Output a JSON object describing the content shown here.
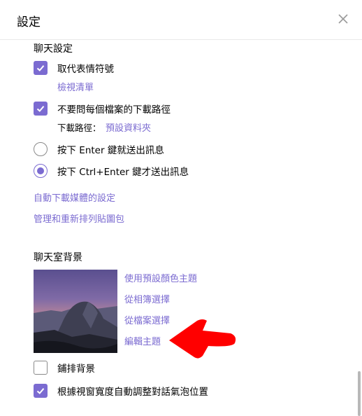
{
  "dialog": {
    "title": "設定",
    "close_icon": "close-icon"
  },
  "chat_settings": {
    "section_title": "聊天設定",
    "replace_emoji": {
      "label": "取代表情符號",
      "checked": true
    },
    "view_list_link": "檢視清單",
    "no_ask_download": {
      "label": "不要問每個檔案的下載路徑",
      "checked": true
    },
    "download_path_label": "下載路徑：",
    "download_path_value": "預設資料夾",
    "send_enter": {
      "label": "按下 Enter 鍵就送出訊息",
      "selected": false
    },
    "send_ctrl_enter": {
      "label": "按下 Ctrl+Enter 鍵才送出訊息",
      "selected": true
    },
    "auto_download_link": "自動下載媒體的設定",
    "manage_stickers_link": "管理和重新排列貼圖包"
  },
  "chat_background": {
    "section_title": "聊天室背景",
    "use_default_theme": "使用預設顏色主題",
    "choose_from_album": "從相簿選擇",
    "choose_from_file": "從檔案選擇",
    "edit_theme": "編輯主題",
    "tile_background": {
      "label": "鋪排背景",
      "checked": false
    },
    "adaptive_bubbles": {
      "label": "根據視窗寬度自動調整對話氣泡位置",
      "checked": true
    }
  },
  "colors": {
    "accent": "#7b6bd1",
    "annotation": "#ff0000"
  }
}
